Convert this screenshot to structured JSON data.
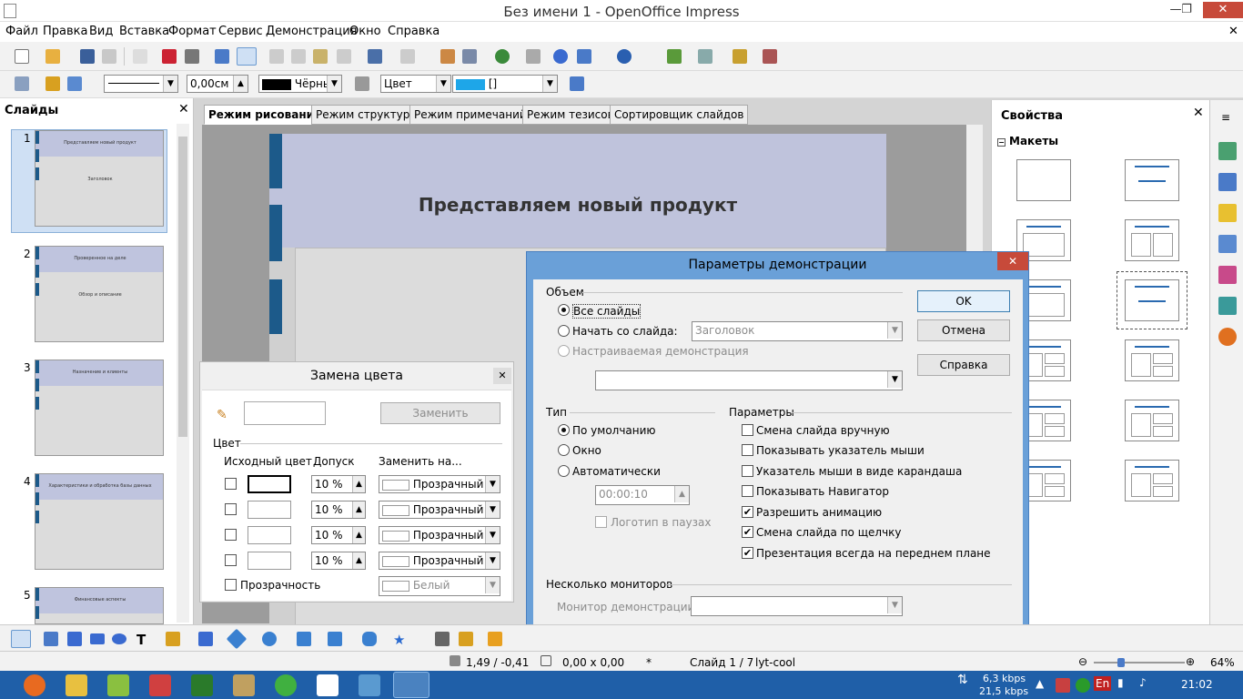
{
  "window": {
    "title": "Без имени 1 - OpenOffice Impress"
  },
  "menu": [
    "Файл",
    "Правка",
    "Вид",
    "Вставка",
    "Формат",
    "Сервис",
    "Демонстрация",
    "Окно",
    "Справка"
  ],
  "toolbar2": {
    "line_width": "0,00см",
    "line_color": "Чёрнь",
    "area_style": "Цвет",
    "area_color": "[]"
  },
  "slides_pane": {
    "title": "Слайды",
    "slides": [
      {
        "num": "1",
        "title": "Представляем новый продукт",
        "sub": "Заголовок"
      },
      {
        "num": "2",
        "title": "Проверенное на деле",
        "sub": "Обзор и описание"
      },
      {
        "num": "3",
        "title": "Назначение и клиенты",
        "sub": ""
      },
      {
        "num": "4",
        "title": "Характеристики и обработка базы данных",
        "sub": ""
      },
      {
        "num": "5",
        "title": "Финансовые аспекты",
        "sub": ""
      }
    ]
  },
  "view_tabs": [
    "Режим рисования",
    "Режим структуры",
    "Режим примечаний",
    "Режим тезисов",
    "Сортировщик слайдов"
  ],
  "slide": {
    "title": "Представляем новый продукт"
  },
  "properties": {
    "title": "Свойства",
    "section": "Макеты"
  },
  "color_replacer": {
    "title": "Замена цвета",
    "replace_button": "Заменить",
    "group": "Цвет",
    "col_source": "Исходный цвет",
    "col_tolerance": "Допуск",
    "col_replace": "Заменить на...",
    "rows": [
      {
        "tolerance": "10 %",
        "replace": "Прозрачный"
      },
      {
        "tolerance": "10 %",
        "replace": "Прозрачный"
      },
      {
        "tolerance": "10 %",
        "replace": "Прозрачный"
      },
      {
        "tolerance": "10 %",
        "replace": "Прозрачный"
      }
    ],
    "transparency_label": "Прозрачность",
    "transparency_value": "Белый"
  },
  "slideshow_dialog": {
    "title": "Параметры демонстрации",
    "range_group": "Объем",
    "all_slides": "Все слайды",
    "from_slide": "Начать со слайда:",
    "from_slide_value": "Заголовок",
    "custom_show": "Настраиваемая демонстрация",
    "type_group": "Тип",
    "type_default": "По умолчанию",
    "type_window": "Окно",
    "type_auto": "Автоматически",
    "pause_time": "00:00:10",
    "logo_in_pauses": "Логотип в паузах",
    "options_group": "Параметры",
    "options": [
      {
        "label": "Смена слайда вручную",
        "checked": false
      },
      {
        "label": "Показывать указатель мыши",
        "checked": false
      },
      {
        "label": "Указатель мыши в виде карандаша",
        "checked": false
      },
      {
        "label": "Показывать Навигатор",
        "checked": false
      },
      {
        "label": "Разрешить анимацию",
        "checked": true
      },
      {
        "label": "Смена слайда по щелчку",
        "checked": true
      },
      {
        "label": "Презентация всегда на переднем плане",
        "checked": true
      }
    ],
    "monitors_group": "Несколько мониторов",
    "monitor_label": "Монитор демонстрации",
    "ok": "OK",
    "cancel": "Отмена",
    "help": "Справка"
  },
  "statusbar": {
    "position": "1,49 / -0,41",
    "size": "0,00 x 0,00",
    "modified": "*",
    "slide": "Слайд 1 / 7",
    "layout": "lyt-cool",
    "zoom": "64%"
  },
  "taskbar": {
    "net_up": "6,3 kbps",
    "net_down": "21,5 kbps",
    "lang": "En",
    "time": "21:02"
  }
}
